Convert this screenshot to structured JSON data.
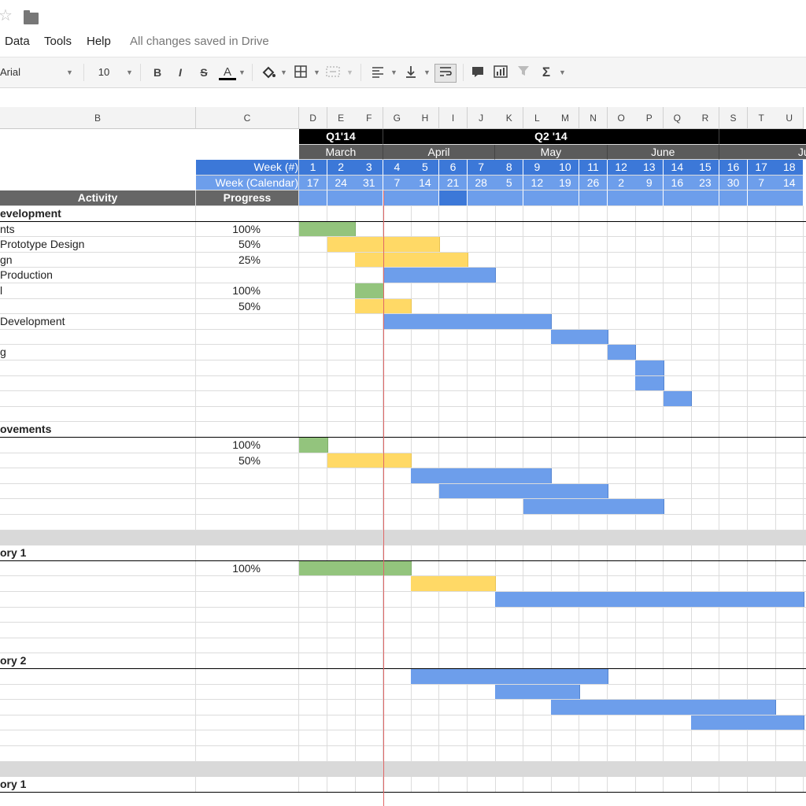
{
  "app": {
    "menu": [
      "Data",
      "Tools",
      "Help"
    ],
    "status": "All changes saved in Drive",
    "star_icon": "star-icon",
    "folder_icon": "folder-icon"
  },
  "toolbar": {
    "font": "Arial",
    "font_size": "10",
    "bold": "B",
    "italic": "I",
    "strike": "S",
    "text_color": "A",
    "functions": "Σ"
  },
  "columns": [
    "B",
    "C",
    "D",
    "E",
    "F",
    "G",
    "H",
    "I",
    "J",
    "K",
    "L",
    "M",
    "N",
    "O",
    "P",
    "Q",
    "R",
    "S",
    "T",
    "U"
  ],
  "header": {
    "quarters": [
      "Q1'14",
      "Q2 '14"
    ],
    "months": [
      "March",
      "April",
      "May",
      "June",
      "Jul"
    ],
    "week_num_label": "Week (#)",
    "week_cal_label": "Week (Calendar)",
    "week_nums": [
      "1",
      "2",
      "3",
      "4",
      "5",
      "6",
      "7",
      "8",
      "9",
      "10",
      "11",
      "12",
      "13",
      "14",
      "15",
      "16",
      "17",
      "18"
    ],
    "week_cal": [
      "17",
      "24",
      "31",
      "7",
      "14",
      "21",
      "28",
      "5",
      "12",
      "19",
      "26",
      "2",
      "9",
      "16",
      "23",
      "30",
      "7",
      "14"
    ],
    "activity_label": "Activity",
    "progress_label": "Progress"
  },
  "rows": [
    {
      "activity": "evelopment",
      "progress": "",
      "section": true,
      "bars": []
    },
    {
      "activity": "nts",
      "progress": "100%",
      "bars": [
        {
          "c": "g",
          "s": 0,
          "e": 2
        }
      ]
    },
    {
      "activity": "Prototype Design",
      "progress": "50%",
      "bars": [
        {
          "c": "y",
          "s": 1,
          "e": 5
        }
      ]
    },
    {
      "activity": "gn",
      "progress": "25%",
      "bars": [
        {
          "c": "y",
          "s": 2,
          "e": 6
        }
      ]
    },
    {
      "activity": "Production",
      "progress": "",
      "bars": [
        {
          "c": "b",
          "s": 3,
          "e": 7
        }
      ]
    },
    {
      "activity": "l",
      "progress": "100%",
      "bars": [
        {
          "c": "g",
          "s": 2,
          "e": 3
        }
      ]
    },
    {
      "activity": "",
      "progress": "50%",
      "bars": [
        {
          "c": "y",
          "s": 2,
          "e": 4
        }
      ]
    },
    {
      "activity": "Development",
      "progress": "",
      "bars": [
        {
          "c": "b",
          "s": 3,
          "e": 9
        }
      ]
    },
    {
      "activity": "",
      "progress": "",
      "bars": [
        {
          "c": "b",
          "s": 9,
          "e": 11
        }
      ]
    },
    {
      "activity": "g",
      "progress": "",
      "bars": [
        {
          "c": "b",
          "s": 11,
          "e": 12
        }
      ]
    },
    {
      "activity": "",
      "progress": "",
      "bars": [
        {
          "c": "b",
          "s": 12,
          "e": 13
        }
      ]
    },
    {
      "activity": "",
      "progress": "",
      "bars": [
        {
          "c": "b",
          "s": 12,
          "e": 13
        }
      ]
    },
    {
      "activity": "",
      "progress": "",
      "bars": [
        {
          "c": "b",
          "s": 13,
          "e": 14
        }
      ]
    },
    {
      "activity": "",
      "progress": "",
      "bars": []
    },
    {
      "activity": "ovements",
      "progress": "",
      "section": true,
      "bars": []
    },
    {
      "activity": "",
      "progress": "100%",
      "bars": [
        {
          "c": "g",
          "s": 0,
          "e": 1
        }
      ]
    },
    {
      "activity": "",
      "progress": "50%",
      "bars": [
        {
          "c": "y",
          "s": 1,
          "e": 4
        }
      ]
    },
    {
      "activity": "",
      "progress": "",
      "bars": [
        {
          "c": "b",
          "s": 4,
          "e": 9
        }
      ]
    },
    {
      "activity": "",
      "progress": "",
      "bars": [
        {
          "c": "b",
          "s": 5,
          "e": 11
        }
      ]
    },
    {
      "activity": "",
      "progress": "",
      "bars": [
        {
          "c": "b",
          "s": 8,
          "e": 13
        }
      ]
    },
    {
      "activity": "",
      "progress": "",
      "bars": []
    },
    {
      "activity": "",
      "progress": "",
      "gray": true,
      "bars": []
    },
    {
      "activity": "ory 1",
      "progress": "",
      "section": true,
      "bars": []
    },
    {
      "activity": "",
      "progress": "100%",
      "bars": [
        {
          "c": "g",
          "s": 0,
          "e": 4
        }
      ]
    },
    {
      "activity": "",
      "progress": "",
      "bars": [
        {
          "c": "y",
          "s": 4,
          "e": 7
        }
      ]
    },
    {
      "activity": "",
      "progress": "",
      "bars": [
        {
          "c": "b",
          "s": 7,
          "e": 18
        }
      ]
    },
    {
      "activity": "",
      "progress": "",
      "bars": []
    },
    {
      "activity": "",
      "progress": "",
      "bars": []
    },
    {
      "activity": "",
      "progress": "",
      "bars": []
    },
    {
      "activity": "ory 2",
      "progress": "",
      "section": true,
      "bars": []
    },
    {
      "activity": "",
      "progress": "",
      "bars": [
        {
          "c": "b",
          "s": 4,
          "e": 11
        }
      ]
    },
    {
      "activity": "",
      "progress": "",
      "bars": [
        {
          "c": "b",
          "s": 7,
          "e": 10
        }
      ]
    },
    {
      "activity": "",
      "progress": "",
      "bars": [
        {
          "c": "b",
          "s": 9,
          "e": 17
        }
      ]
    },
    {
      "activity": "",
      "progress": "",
      "bars": [
        {
          "c": "b",
          "s": 14,
          "e": 18
        }
      ]
    },
    {
      "activity": "",
      "progress": "",
      "bars": []
    },
    {
      "activity": "",
      "progress": "",
      "bars": []
    },
    {
      "activity": "",
      "progress": "",
      "gray": true,
      "bars": []
    },
    {
      "activity": "ory 1",
      "progress": "",
      "section": true,
      "bars": []
    }
  ],
  "colors": {
    "green": "#93c47d",
    "yellow": "#ffd966",
    "blue": "#6d9eeb",
    "today": "#e06666"
  }
}
